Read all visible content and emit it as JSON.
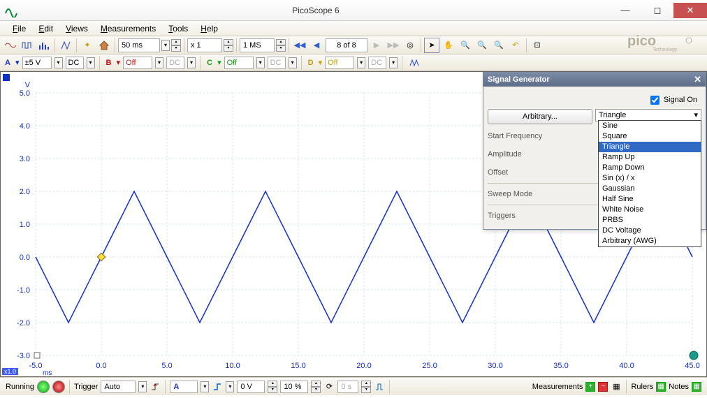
{
  "window": {
    "title": "PicoScope 6"
  },
  "menu": {
    "file": "File",
    "edit": "Edit",
    "views": "Views",
    "measurements": "Measurements",
    "tools": "Tools",
    "help": "Help"
  },
  "toolbar": {
    "timebase": "50 ms",
    "xscale": "x 1",
    "samples": "1 MS",
    "page": "8 of 8"
  },
  "channels": {
    "a": {
      "label": "A",
      "range": "±5 V",
      "coupling": "DC"
    },
    "b": {
      "label": "B",
      "range": "Off",
      "coupling": "DC"
    },
    "c": {
      "label": "C",
      "range": "Off",
      "coupling": "DC"
    },
    "d": {
      "label": "D",
      "range": "Off",
      "coupling": "DC"
    }
  },
  "plot": {
    "y_label": "V",
    "y_ticks": [
      "5.0",
      "4.0",
      "3.0",
      "2.0",
      "1.0",
      "0.0",
      "-1.0",
      "-2.0",
      "-3.0"
    ],
    "x_label": "ms",
    "x_ticks": [
      "-5.0",
      "0.0",
      "5.0",
      "10.0",
      "15.0",
      "20.0",
      "25.0",
      "30.0",
      "35.0",
      "40.0",
      "45.0"
    ],
    "zoom_tag": "x1.0"
  },
  "chart_data": {
    "type": "line",
    "title": "",
    "xlabel": "ms",
    "ylabel": "V",
    "xlim": [
      -5,
      45
    ],
    "ylim": [
      -3,
      5
    ],
    "series": [
      {
        "name": "Channel A",
        "color": "#1030c0",
        "x": [
          -5,
          -2.5,
          0,
          2.5,
          5,
          7.5,
          10,
          12.5,
          15,
          17.5,
          20,
          22.5,
          25,
          27.5,
          30,
          32.5,
          35,
          37.5,
          40,
          42.5,
          45
        ],
        "y": [
          0,
          -2,
          0,
          2,
          0,
          -2,
          0,
          2,
          0,
          -2,
          0,
          2,
          0,
          -2,
          0,
          2,
          0,
          -2,
          0,
          2,
          0
        ]
      }
    ]
  },
  "siggen": {
    "title": "Signal Generator",
    "signal_on": "Signal On",
    "arbitrary_btn": "Arbitrary...",
    "waveform": "Triangle",
    "labels": {
      "start_freq": "Start Frequency",
      "amplitude": "Amplitude",
      "offset": "Offset",
      "sweep": "Sweep Mode",
      "triggers": "Triggers"
    },
    "options": [
      "Sine",
      "Square",
      "Triangle",
      "Ramp Up",
      "Ramp Down",
      "Sin (x) / x",
      "Gaussian",
      "Half Sine",
      "White Noise",
      "PRBS",
      "DC Voltage",
      "Arbitrary (AWG)"
    ],
    "selected": "Triangle"
  },
  "status": {
    "running": "Running",
    "trigger": "Trigger",
    "trigger_mode": "Auto",
    "trigger_ch": "A",
    "level": "0 V",
    "pretrigger": "10 %",
    "delay": "0 s",
    "measurements": "Measurements",
    "rulers": "Rulers",
    "notes": "Notes"
  },
  "logo": {
    "brand": "pico",
    "sub": "Technology"
  }
}
